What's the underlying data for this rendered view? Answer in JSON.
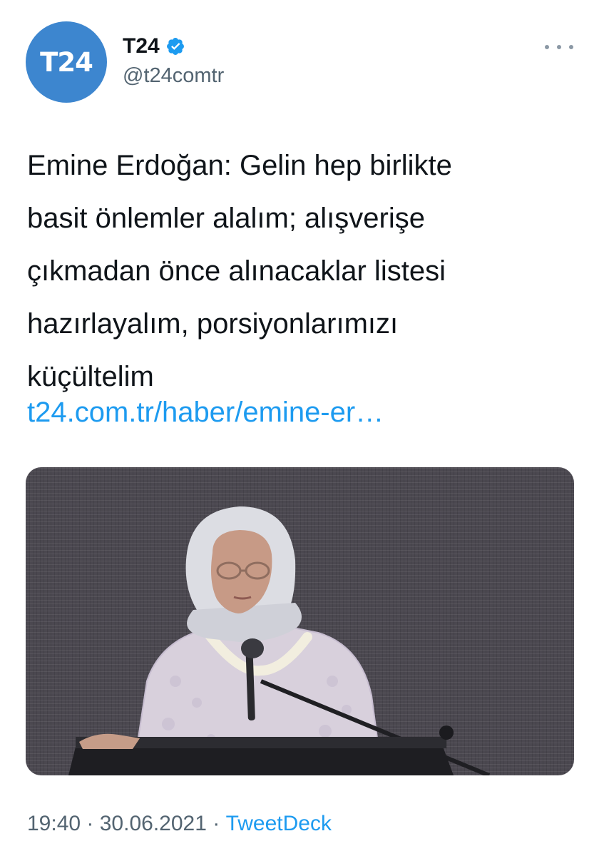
{
  "author": {
    "avatar_text": "T24",
    "display_name": "T24",
    "handle": "@t24comtr",
    "avatar_color": "#3d86cf",
    "verified_icon": "verified-badge-icon"
  },
  "tweet": {
    "text": "Emine Erdoğan: Gelin hep birlikte\nbasit önlemler alalım; alışverişe\nçıkmadan önce alınacaklar listesi\nhazırlayalım, porsiyonlarımızı\nküçültelim",
    "link": "t24.com.tr/haber/emine-er…"
  },
  "meta": {
    "time": "19:40",
    "sep1": " · ",
    "date": "30.06.2021",
    "sep2": " · ",
    "source": "TweetDeck"
  },
  "colors": {
    "link": "#1d9bf0",
    "secondary_text": "#536471",
    "primary_text": "#0f1419"
  }
}
